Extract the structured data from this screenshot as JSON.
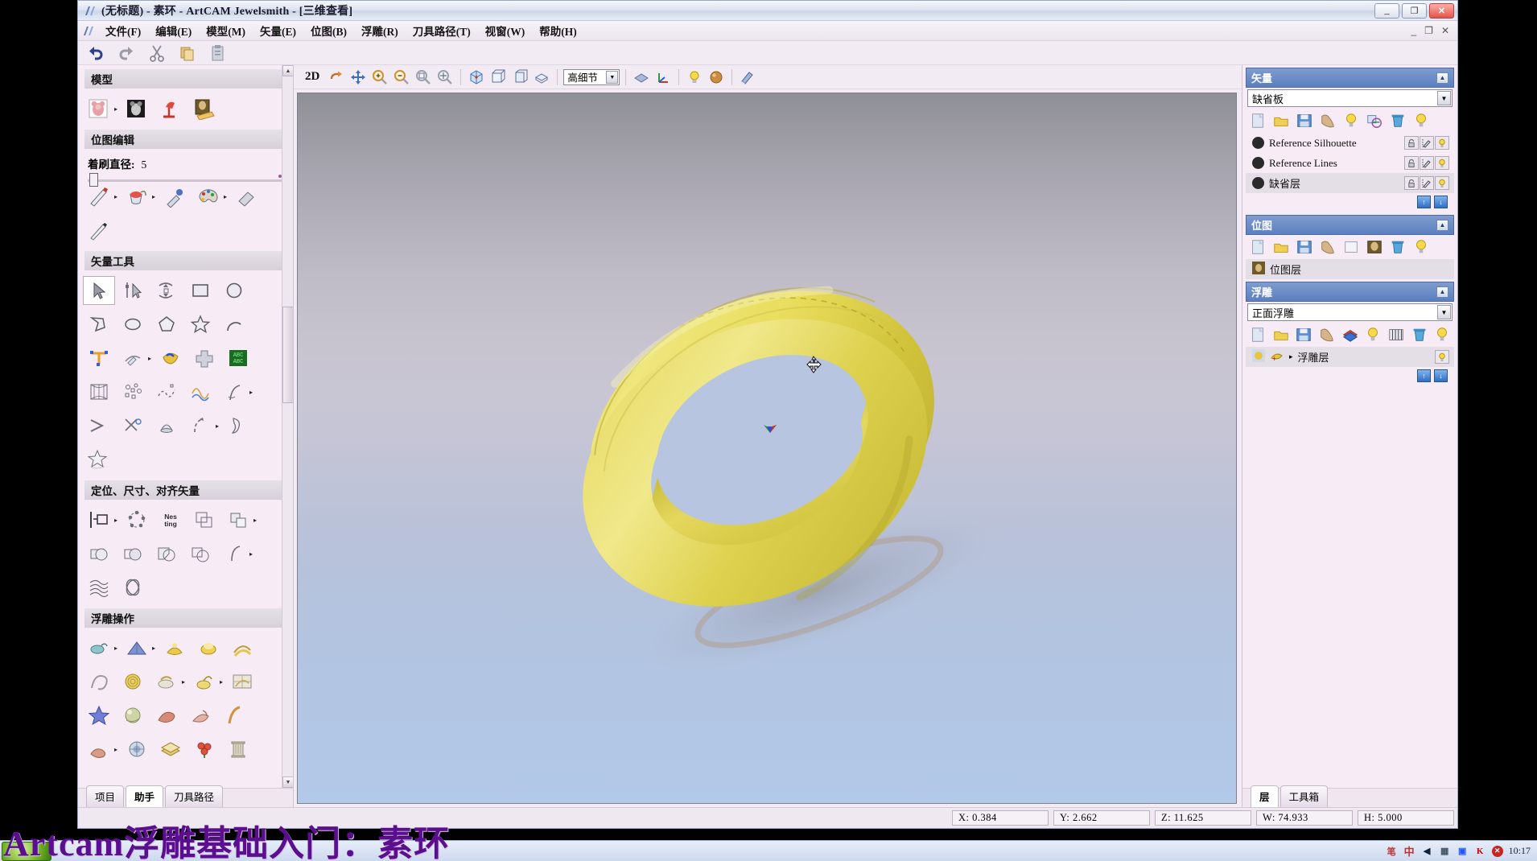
{
  "window": {
    "title": "(无标题) - 素环 - ArtCAM Jewelsmith - [三维查看]",
    "minimize": "_",
    "maximize": "❐",
    "close": "✕",
    "inner_minimize": "_",
    "inner_restore": "❐",
    "inner_close": "✕"
  },
  "menubar": {
    "items": [
      {
        "label": "文件(F)"
      },
      {
        "label": "编辑(E)"
      },
      {
        "label": "模型(M)"
      },
      {
        "label": "矢量(E)"
      },
      {
        "label": "位图(B)"
      },
      {
        "label": "浮雕(R)"
      },
      {
        "label": "刀具路径(T)"
      },
      {
        "label": "视窗(W)"
      },
      {
        "label": "帮助(H)"
      }
    ]
  },
  "toolbar": {
    "items": [
      {
        "name": "undo-icon",
        "glyph": "↶"
      },
      {
        "name": "redo-icon",
        "glyph": "↷"
      },
      {
        "name": "cut-icon",
        "glyph": "✂"
      },
      {
        "name": "copy-icon",
        "glyph": "❐"
      },
      {
        "name": "paste-icon",
        "glyph": "📋"
      }
    ]
  },
  "left_panel": {
    "sections": [
      {
        "id": "model",
        "title": "模型",
        "rows": [
          [
            {
              "name": "new-model-icon",
              "kind": "img-bear",
              "arrow": true
            },
            {
              "name": "model-grayscale-icon",
              "kind": "img-gray"
            },
            {
              "name": "model-lamp-icon",
              "kind": "img-lamp"
            },
            {
              "name": "model-photo-icon",
              "kind": "img-photo"
            }
          ]
        ]
      },
      {
        "id": "bitmap-edit",
        "title": "位图编辑",
        "slider": {
          "label": "着刷直径:",
          "value": "5"
        },
        "rows": [
          [
            {
              "name": "pencil-icon",
              "kind": "pencil",
              "arrow": true
            },
            {
              "name": "paint-bucket-icon",
              "kind": "bucket",
              "arrow": true
            },
            {
              "name": "eyedropper-icon",
              "kind": "dropper"
            },
            {
              "name": "palette-icon",
              "kind": "palette",
              "arrow": true
            },
            {
              "name": "eraser-icon",
              "kind": "eraser"
            }
          ],
          [
            {
              "name": "line-tool-icon",
              "kind": "pen"
            }
          ]
        ]
      },
      {
        "id": "vector-tools",
        "title": "矢量工具",
        "rows": [
          [
            {
              "name": "select-arrow-tool",
              "kind": "arrow",
              "selected": true
            },
            {
              "name": "node-edit-tool",
              "kind": "nodeedit"
            },
            {
              "name": "transform-tool",
              "kind": "transform"
            },
            {
              "name": "rectangle-tool",
              "kind": "rect"
            },
            {
              "name": "ellipse-tool",
              "kind": "circle"
            }
          ],
          [
            {
              "name": "polyline-tool",
              "kind": "polyline"
            },
            {
              "name": "oval-tool",
              "kind": "oval"
            },
            {
              "name": "polygon-tool",
              "kind": "pentagon"
            },
            {
              "name": "star-tool",
              "kind": "star"
            },
            {
              "name": "arc-tool",
              "kind": "arc"
            }
          ],
          [
            {
              "name": "text-tool",
              "kind": "text"
            },
            {
              "name": "text-on-curve-tool",
              "kind": "textcurve",
              "arrow": true
            },
            {
              "name": "gem-tool",
              "kind": "gem"
            },
            {
              "name": "cross-tool",
              "kind": "cross"
            },
            {
              "name": "abc-grid-tool",
              "kind": "abcgrid"
            }
          ],
          [
            {
              "name": "mesh-tool",
              "kind": "mesh"
            },
            {
              "name": "scatter-tool",
              "kind": "scatter"
            },
            {
              "name": "curve-fit-tool",
              "kind": "curvefit"
            },
            {
              "name": "wave-tool",
              "kind": "wave"
            },
            {
              "name": "spline-tool",
              "kind": "spline",
              "arrow": true
            }
          ],
          [
            {
              "name": "offset-tool",
              "kind": "offset"
            },
            {
              "name": "trim-tool",
              "kind": "trim"
            },
            {
              "name": "bevel-tool",
              "kind": "bevel"
            },
            {
              "name": "join-tool",
              "kind": "join",
              "arrow": true
            },
            {
              "name": "shape-tool",
              "kind": "shape"
            }
          ],
          [
            {
              "name": "star-fill-tool",
              "kind": "starfill"
            }
          ]
        ]
      },
      {
        "id": "align-vectors",
        "title": "定位、尺寸、对齐矢量",
        "rows": [
          [
            {
              "name": "align-left-tool",
              "kind": "alignleft",
              "arrow": true
            },
            {
              "name": "circular-array-tool",
              "kind": "circarray"
            },
            {
              "name": "nesting-tool",
              "kind": "nesting"
            },
            {
              "name": "block-copy-tool",
              "kind": "blockcopy"
            },
            {
              "name": "duplicate-tool",
              "kind": "duplicate",
              "arrow": true
            }
          ],
          [
            {
              "name": "weld-tool",
              "kind": "weld"
            },
            {
              "name": "subtract-tool",
              "kind": "subtract"
            },
            {
              "name": "intersect-tool",
              "kind": "intersect"
            },
            {
              "name": "combine-tool",
              "kind": "combine"
            },
            {
              "name": "fillet-tool",
              "kind": "fillet",
              "arrow": true
            }
          ],
          [
            {
              "name": "texture-weave-tool",
              "kind": "weave"
            },
            {
              "name": "knot-tool",
              "kind": "knot"
            }
          ]
        ]
      },
      {
        "id": "relief-ops",
        "title": "浮雕操作",
        "rows": [
          [
            {
              "name": "relief-shape-editor",
              "kind": "rshape",
              "arrow": true
            },
            {
              "name": "relief-extrude",
              "kind": "rextrude",
              "arrow": true
            },
            {
              "name": "relief-spin",
              "kind": "rspin"
            },
            {
              "name": "relief-turn",
              "kind": "rturn"
            },
            {
              "name": "relief-two-rail",
              "kind": "rtworail"
            }
          ],
          [
            {
              "name": "relief-wrap",
              "kind": "rwrap"
            },
            {
              "name": "relief-texture",
              "kind": "rtexture"
            },
            {
              "name": "relief-smooth",
              "kind": "rsmooth",
              "arrow": true
            },
            {
              "name": "relief-bulge",
              "kind": "rbulge",
              "arrow": true
            },
            {
              "name": "relief-tile",
              "kind": "rtile"
            }
          ],
          [
            {
              "name": "relief-star-emboss",
              "kind": "rstar"
            },
            {
              "name": "relief-sphere",
              "kind": "rsphere"
            },
            {
              "name": "relief-sculpt",
              "kind": "rsculpt"
            },
            {
              "name": "relief-erase",
              "kind": "rerase"
            },
            {
              "name": "relief-curve",
              "kind": "rcurve"
            }
          ],
          [
            {
              "name": "relief-clay",
              "kind": "rclay",
              "arrow": true
            },
            {
              "name": "relief-render",
              "kind": "rrender"
            },
            {
              "name": "relief-layer",
              "kind": "rlayer"
            },
            {
              "name": "relief-flower",
              "kind": "rflower"
            },
            {
              "name": "relief-column",
              "kind": "rcolumn"
            }
          ]
        ]
      }
    ],
    "tabs": [
      {
        "label": "项目",
        "active": false
      },
      {
        "label": "助手",
        "active": true
      },
      {
        "label": "刀具路径",
        "active": false
      }
    ]
  },
  "viewport": {
    "toolbar": {
      "mode_label": "2D",
      "buttons": [
        {
          "name": "rotate-view-icon",
          "glyph": "↷"
        },
        {
          "name": "pan-view-icon",
          "glyph": "✥"
        },
        {
          "name": "zoom-in-icon",
          "glyph": "⊕"
        },
        {
          "name": "zoom-out-icon",
          "glyph": "⊖"
        },
        {
          "name": "zoom-window-icon",
          "glyph": "⌕"
        },
        {
          "name": "zoom-fit-icon",
          "glyph": "⛶"
        },
        {
          "name": "iso-view-icon",
          "glyph": "◈"
        },
        {
          "name": "front-view-icon",
          "glyph": "▣"
        },
        {
          "name": "side-view-icon",
          "glyph": "▤"
        },
        {
          "name": "top-view-icon",
          "glyph": "▥"
        }
      ],
      "detail_select": "高细节",
      "buttons_right": [
        {
          "name": "shading-icon",
          "glyph": "◆"
        },
        {
          "name": "axes-icon",
          "glyph": "⊥"
        },
        {
          "name": "light-icon",
          "glyph": "💡"
        },
        {
          "name": "material-icon",
          "glyph": "⬤"
        },
        {
          "name": "paint-icon",
          "glyph": "🖌"
        }
      ]
    },
    "cursors": {
      "move": "move-cursor",
      "axes": "axes-gizmo"
    }
  },
  "right_panel": {
    "sections": [
      {
        "id": "vector",
        "title": "矢量",
        "combo": "缺省板",
        "icons": [
          {
            "name": "new-layer-icon",
            "glyph": "📄"
          },
          {
            "name": "open-layer-icon",
            "glyph": "📂"
          },
          {
            "name": "save-layer-icon",
            "glyph": "💾"
          },
          {
            "name": "import-layer-icon",
            "glyph": "📥"
          },
          {
            "name": "export-layer-icon",
            "glyph": "💡"
          },
          {
            "name": "merge-layer-icon",
            "glyph": "⧉"
          },
          {
            "name": "delete-layer-icon",
            "glyph": "🗑"
          },
          {
            "name": "show-all-layers-icon",
            "glyph": "💡"
          }
        ],
        "layers": [
          {
            "name": "Reference Silhouette",
            "alt": false
          },
          {
            "name": "Reference Lines",
            "alt": false
          },
          {
            "name": "缺省层",
            "alt": true
          }
        ],
        "has_updown": true
      },
      {
        "id": "bitmap",
        "title": "位图",
        "icons": [
          {
            "name": "new-bitmap-icon",
            "glyph": "📄"
          },
          {
            "name": "open-bitmap-icon",
            "glyph": "📂"
          },
          {
            "name": "save-bitmap-icon",
            "glyph": "💾"
          },
          {
            "name": "import-bitmap-icon",
            "glyph": "📥"
          },
          {
            "name": "blank-bitmap-icon",
            "glyph": "▭"
          },
          {
            "name": "photo-bitmap-icon",
            "glyph": "🖼"
          },
          {
            "name": "delete-bitmap-icon",
            "glyph": "🗑"
          },
          {
            "name": "show-bitmaps-icon",
            "glyph": "💡"
          }
        ],
        "layers": [
          {
            "name": "位图层",
            "alt": true,
            "icon": "photo-thumb"
          }
        ],
        "has_updown": false
      },
      {
        "id": "relief",
        "title": "浮雕",
        "combo": "正面浮雕",
        "icons": [
          {
            "name": "new-relief-icon",
            "glyph": "📄"
          },
          {
            "name": "open-relief-icon",
            "glyph": "📂"
          },
          {
            "name": "save-relief-icon",
            "glyph": "💾"
          },
          {
            "name": "import-relief-icon",
            "glyph": "📥"
          },
          {
            "name": "merge-relief-icon",
            "glyph": "◆"
          },
          {
            "name": "light-relief-icon",
            "glyph": "💡"
          },
          {
            "name": "greyscale-relief-icon",
            "glyph": "▦"
          },
          {
            "name": "delete-relief-icon",
            "glyph": "🗑"
          },
          {
            "name": "show-reliefs-icon",
            "glyph": "💡"
          }
        ],
        "layers": [
          {
            "name": "浮雕层",
            "alt": true,
            "icon": "relief-thumb",
            "expand": "▸"
          }
        ],
        "has_updown": true
      }
    ],
    "tabs": [
      {
        "label": "层",
        "active": true
      },
      {
        "label": "工具箱",
        "active": false
      }
    ]
  },
  "statusbar": {
    "fields": [
      {
        "name": "coord-x",
        "text": "X:  0.384"
      },
      {
        "name": "coord-y",
        "text": "Y:  2.662"
      },
      {
        "name": "coord-z",
        "text": "Z:  11.625"
      },
      {
        "name": "width-w",
        "text": "W:  74.933"
      },
      {
        "name": "height-h",
        "text": "H:  5.000"
      }
    ]
  },
  "overlay": {
    "caption": "Artcam浮雕基础入门：素环",
    "caption_color": "#5b0f8f"
  },
  "taskbar": {
    "ime": "中",
    "tray": [
      {
        "name": "ime-pen-icon",
        "glyph": "笔"
      },
      {
        "name": "ime-chinese-icon",
        "glyph": "中"
      },
      {
        "name": "sound-icon",
        "glyph": "🔊"
      },
      {
        "name": "network-icon",
        "glyph": "🖧"
      },
      {
        "name": "display-icon",
        "glyph": "🖥"
      },
      {
        "name": "kaspersky-icon",
        "glyph": "K"
      },
      {
        "name": "shield-icon",
        "glyph": "✷"
      }
    ],
    "clock": "10:17"
  },
  "colors": {
    "ring_gold": "#e3d64a",
    "panel_bg": "#f7ecf6",
    "header_blue": "#5b7fc0",
    "accent": "#2f6fc4"
  }
}
